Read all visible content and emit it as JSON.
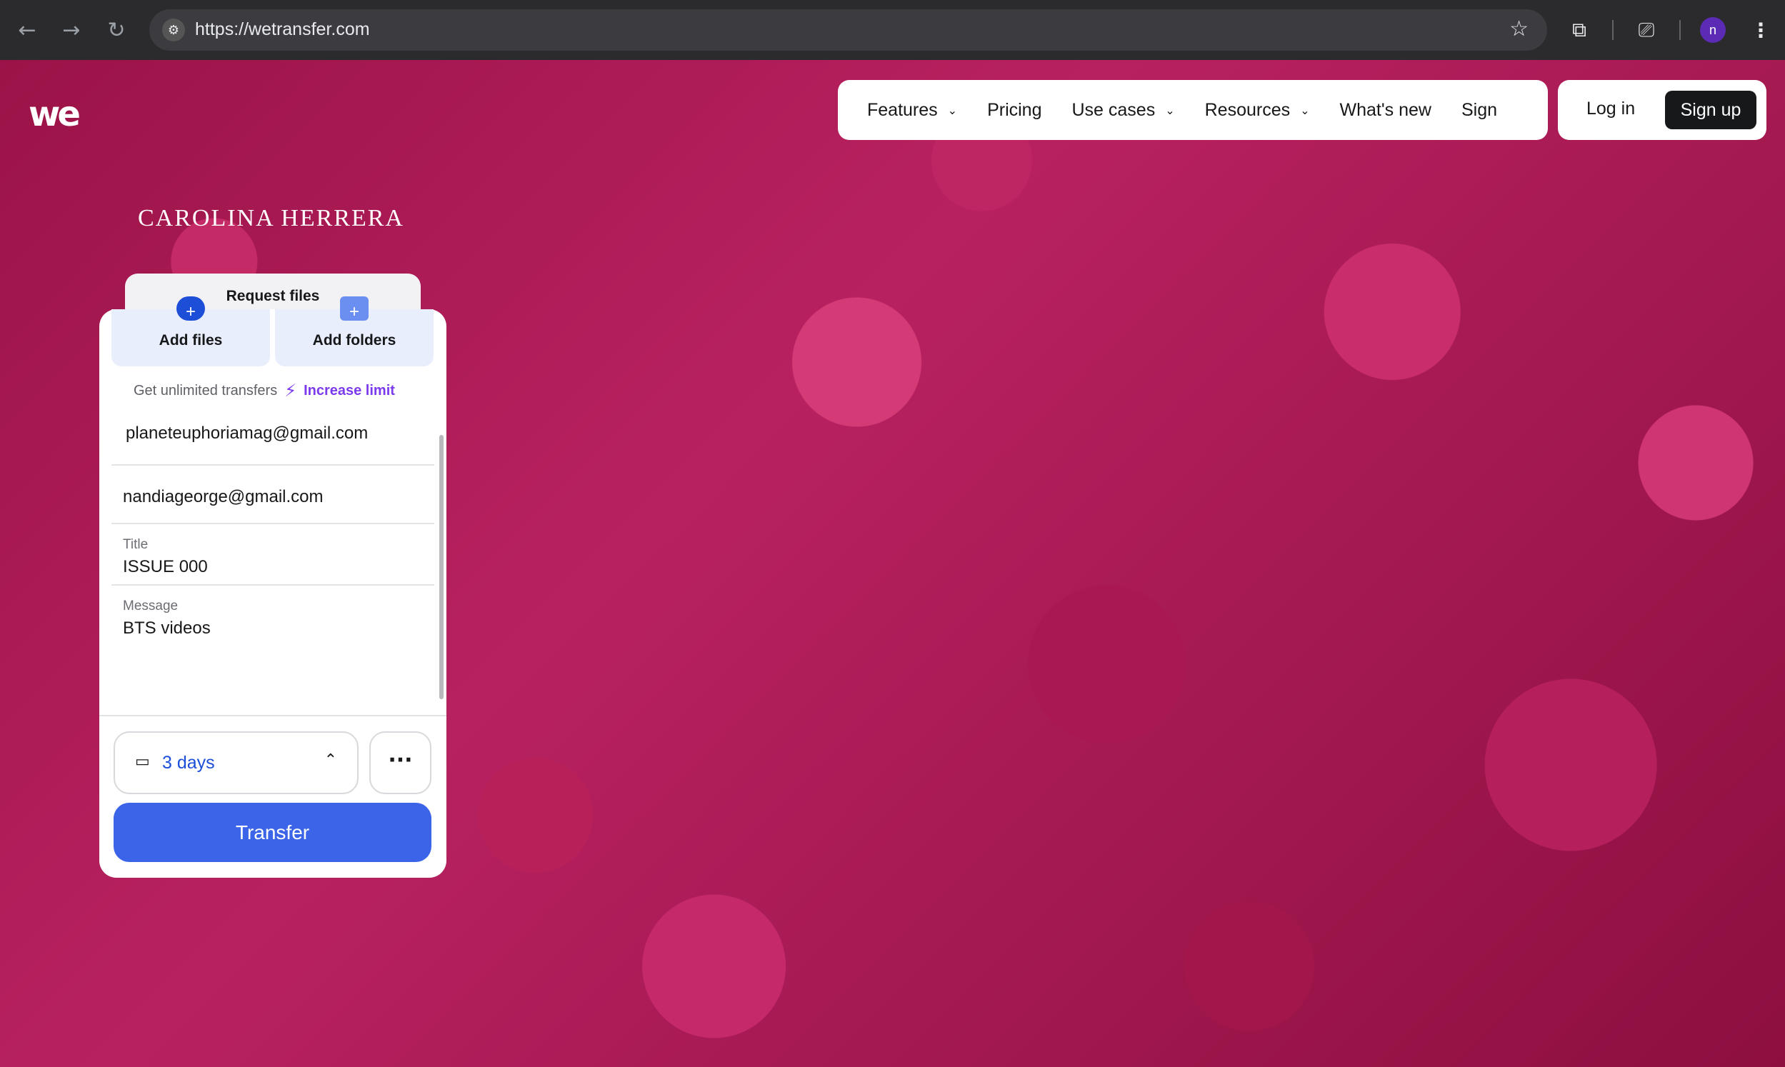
{
  "browser": {
    "url": "https://wetransfer.com",
    "back_icon": "←",
    "forward_icon": "→",
    "reload_icon": "↻",
    "site_icon": "⚙",
    "star_icon": "☆",
    "extensions_icon": "⧉",
    "cast_icon": "⎚",
    "profile_initial": "n"
  },
  "header": {
    "logo": "we",
    "nav": [
      {
        "label": "Features",
        "has_chevron": true
      },
      {
        "label": "Pricing",
        "has_chevron": false
      },
      {
        "label": "Use cases",
        "has_chevron": true
      },
      {
        "label": "Resources",
        "has_chevron": true
      },
      {
        "label": "What's new",
        "has_chevron": false
      },
      {
        "label": "Sign",
        "has_chevron": false
      }
    ],
    "chevron": "⌄",
    "login_label": "Log in",
    "signup_label": "Sign up"
  },
  "brand": "CAROLINA HERRERA",
  "transfer_panel": {
    "request_tab": "Request files",
    "add_files_label": "Add files",
    "add_folders_label": "Add folders",
    "add_icon": "+",
    "limit_text": "Get unlimited transfers",
    "bolt_icon": "⚡",
    "increase_limit": "Increase limit",
    "email_to": "planeteuphoriamag@gmail.com",
    "email_from": "nandiageorge@gmail.com",
    "title_label": "Title",
    "title_value": "ISSUE 000",
    "message_label": "Message",
    "message_value": "BTS videos",
    "calendar_icon": "▭",
    "expiry_value": "3 days",
    "chevron_up": "⌃",
    "more_icon": "···",
    "transfer_label": "Transfer"
  },
  "colors": {
    "accent_blue": "#3b64e8",
    "link_purple": "#7c3aed",
    "background_petals": "#b2205c"
  }
}
